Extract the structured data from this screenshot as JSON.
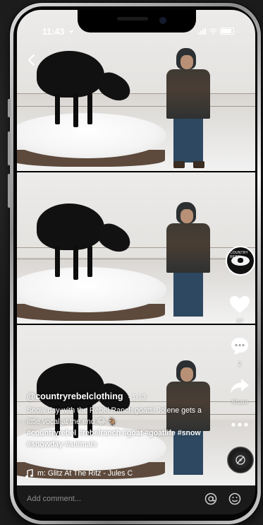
{
  "status": {
    "time": "11:43"
  },
  "author": {
    "handle": "@countryrebelclothing",
    "time_ago": "· 1-13",
    "avatar_text": "COUNTRY REBEL"
  },
  "caption": {
    "text": "Snow day with the Rebel Ranch goats! Jolene gets a little vocal at the end 😂 🐐",
    "hashtags": "#countryrebel #rebelranch #goat #goatlife #snow #snowday #animals"
  },
  "music": {
    "label": "m: Glitz At The Ritz - Jules C"
  },
  "actions": {
    "likes": "27",
    "comments": "2",
    "share_label": "Share"
  },
  "comment_bar": {
    "placeholder": "Add comment..."
  },
  "icons": {
    "back": "chevron-left-icon",
    "like": "heart-icon",
    "comment": "comment-bubble-icon",
    "share": "share-arrow-icon",
    "more": "more-dots-icon",
    "music": "music-note-icon",
    "mention": "at-sign-icon",
    "emoji": "emoji-icon"
  }
}
